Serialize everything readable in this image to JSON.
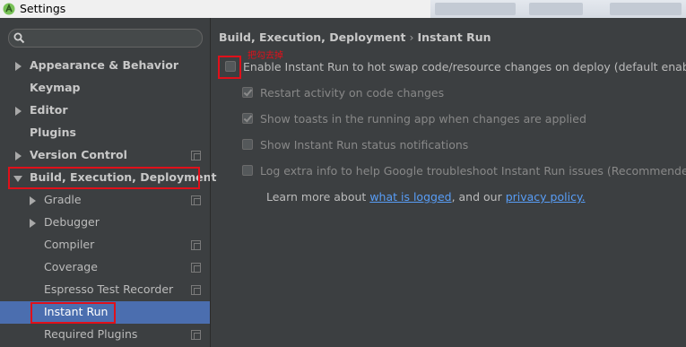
{
  "window": {
    "title": "Settings"
  },
  "sidebar": {
    "search": {
      "placeholder": ""
    },
    "items": [
      {
        "label": "Appearance & Behavior",
        "bold": true,
        "arrow": "right"
      },
      {
        "label": "Keymap",
        "bold": true
      },
      {
        "label": "Editor",
        "bold": true,
        "arrow": "right"
      },
      {
        "label": "Plugins",
        "bold": true
      },
      {
        "label": "Version Control",
        "bold": true,
        "arrow": "right",
        "copy_icon": true
      },
      {
        "label": "Build, Execution, Deployment",
        "bold": true,
        "arrow": "down",
        "highlighted": true
      },
      {
        "label": "Gradle",
        "arrow": "right",
        "copy_icon": true
      },
      {
        "label": "Debugger",
        "arrow": "right"
      },
      {
        "label": "Compiler",
        "copy_icon": true
      },
      {
        "label": "Coverage",
        "copy_icon": true
      },
      {
        "label": "Espresso Test Recorder",
        "copy_icon": true
      },
      {
        "label": "Instant Run",
        "selected": true,
        "highlighted": true
      },
      {
        "label": "Required Plugins",
        "copy_icon": true
      }
    ]
  },
  "main": {
    "breadcrumb": {
      "parent": "Build, Execution, Deployment",
      "separator": "›",
      "current": "Instant Run"
    },
    "annotation": "把勾去掉",
    "options": [
      {
        "label": "Enable Instant Run to hot swap code/resource changes on deploy (default enabled)",
        "checked": false,
        "enabled": true
      },
      {
        "label": "Restart activity on code changes",
        "checked": true,
        "enabled": false
      },
      {
        "label": "Show toasts in the running app when changes are applied",
        "checked": true,
        "enabled": false
      },
      {
        "label": "Show Instant Run status notifications",
        "checked": false,
        "enabled": false
      },
      {
        "label": "Log extra info to help Google troubleshoot Instant Run issues (Recommended)",
        "checked": false,
        "enabled": false
      }
    ],
    "learn_more": {
      "prefix": "Learn more about ",
      "link1": "what is logged",
      "middle": ", and our ",
      "link2": "privacy policy."
    }
  },
  "colors": {
    "accent": "#4b6eaf",
    "annotation": "#e0101a",
    "link": "#589df6"
  }
}
